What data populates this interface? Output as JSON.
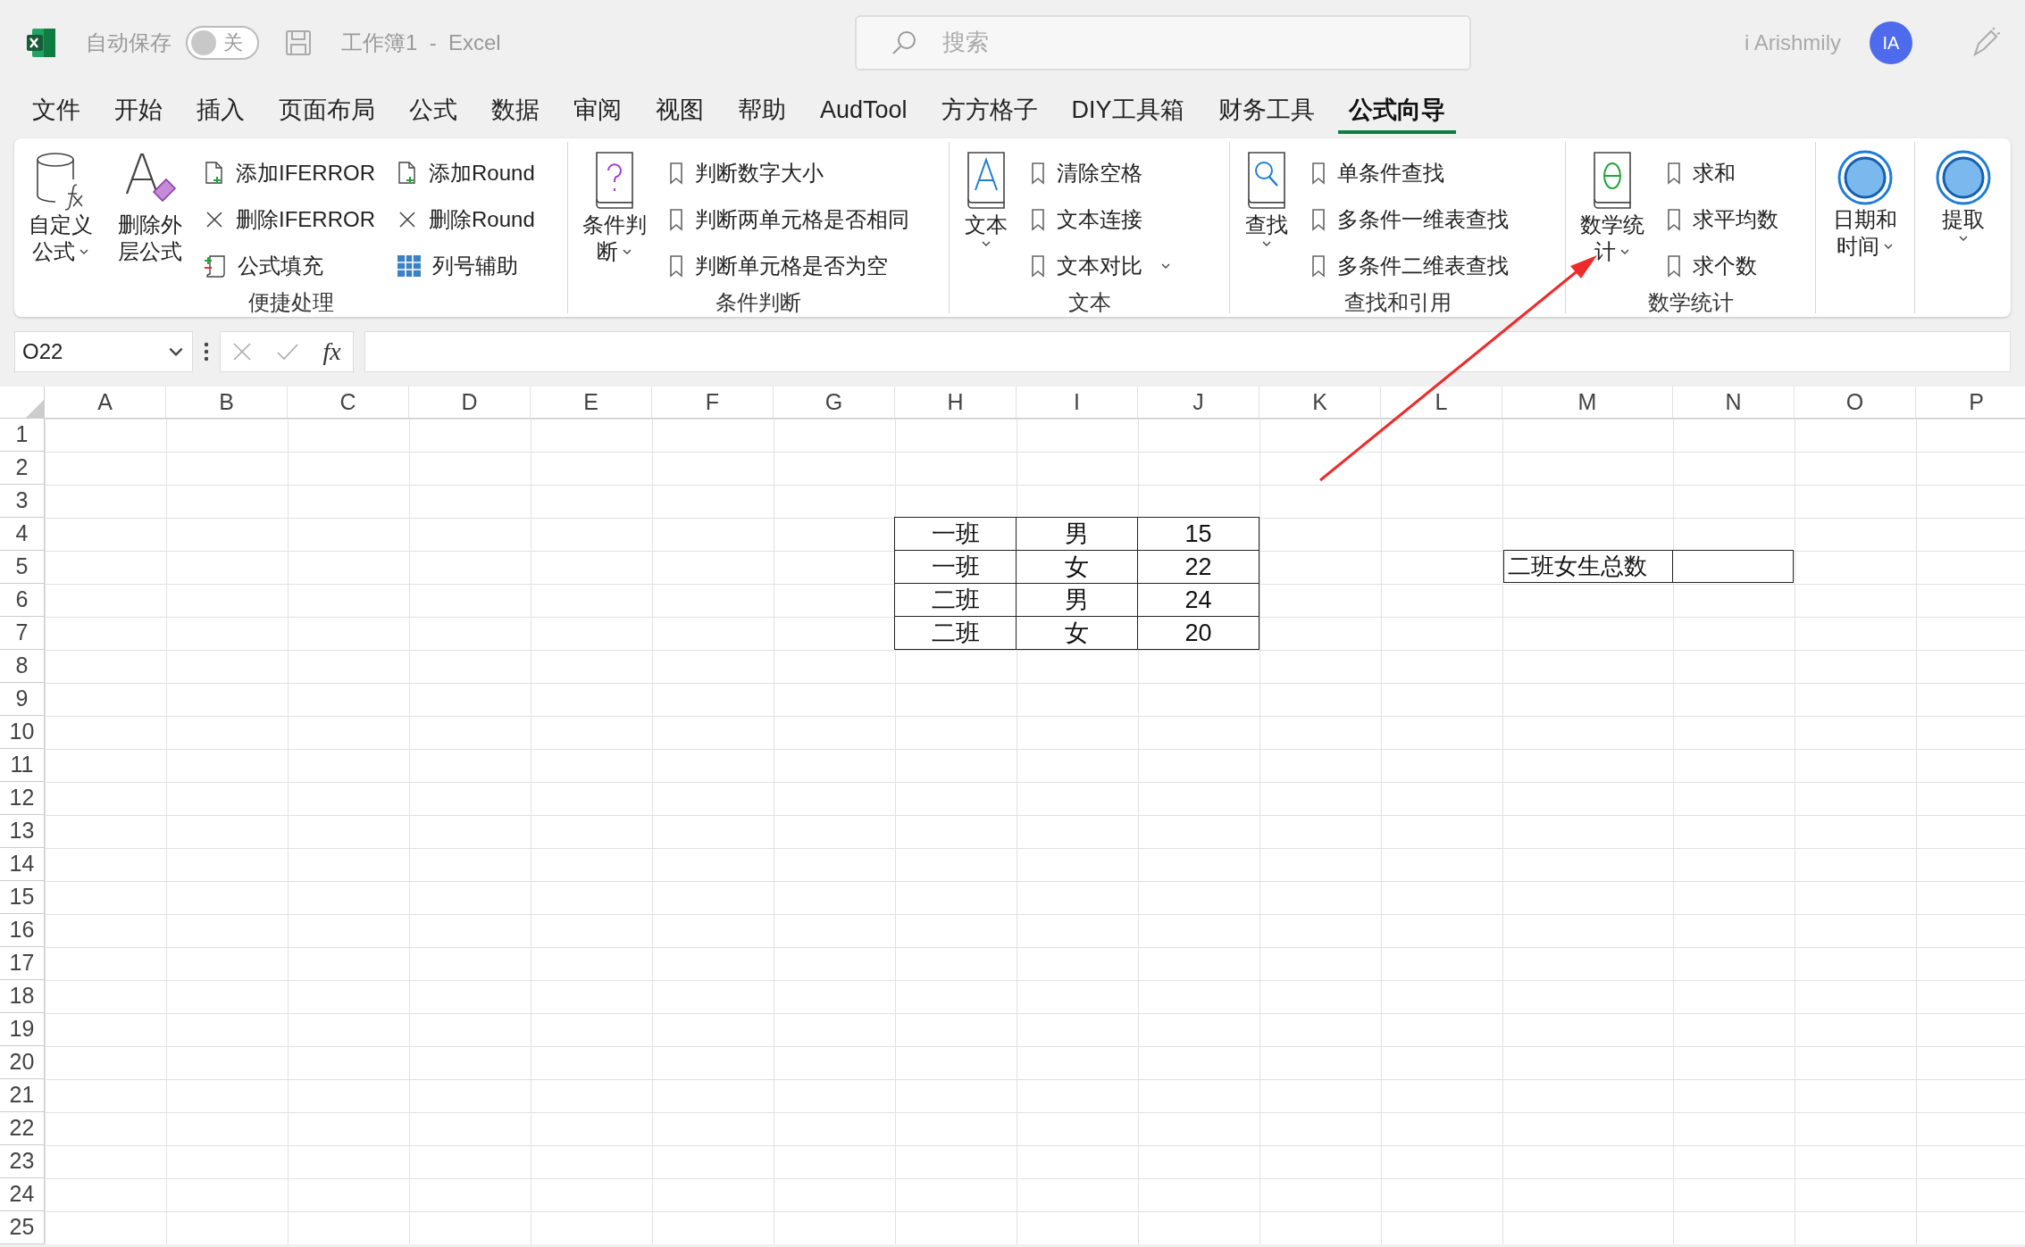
{
  "titlebar": {
    "autosave_label": "自动保存",
    "autosave": {
      "on": false,
      "label": "关"
    },
    "title": "工作簿1  -  Excel",
    "search_placeholder": "搜索",
    "user": "i Arishmily",
    "avatar": "IA"
  },
  "menu_tabs": [
    {
      "label": "文件",
      "selected": false
    },
    {
      "label": "开始",
      "selected": false
    },
    {
      "label": "插入",
      "selected": false
    },
    {
      "label": "页面布局",
      "selected": false
    },
    {
      "label": "公式",
      "selected": false
    },
    {
      "label": "数据",
      "selected": false
    },
    {
      "label": "审阅",
      "selected": false
    },
    {
      "label": "视图",
      "selected": false
    },
    {
      "label": "帮助",
      "selected": false
    },
    {
      "label": "AudTool",
      "selected": false
    },
    {
      "label": "方方格子",
      "selected": false
    },
    {
      "label": "DIY工具箱",
      "selected": false
    },
    {
      "label": "财务工具",
      "selected": false
    },
    {
      "label": "公式向导",
      "selected": true
    }
  ],
  "ribbon_groups": [
    {
      "label": "便捷处理",
      "items": [
        {
          "kind": "large",
          "lines": [
            "自定义",
            "公式"
          ],
          "dropdown": true
        },
        {
          "kind": "large",
          "lines": [
            "删除外",
            "层公式"
          ],
          "dropdown": false
        },
        {
          "kind": "small",
          "label": "添加IFERROR",
          "dropdown": false
        },
        {
          "kind": "small",
          "label": "删除IFERROR",
          "dropdown": false
        },
        {
          "kind": "small",
          "label": "公式填充",
          "dropdown": false
        },
        {
          "kind": "small",
          "label": "添加Round",
          "dropdown": false
        },
        {
          "kind": "small",
          "label": "删除Round",
          "dropdown": false
        },
        {
          "kind": "small",
          "label": "列号辅助",
          "dropdown": false
        }
      ]
    },
    {
      "label": "条件判断",
      "items": [
        {
          "kind": "large",
          "lines": [
            "条件判",
            "断"
          ],
          "dropdown": true
        },
        {
          "kind": "small",
          "label": "判断数字大小",
          "dropdown": false
        },
        {
          "kind": "small",
          "label": "判断两单元格是否相同",
          "dropdown": false
        },
        {
          "kind": "small",
          "label": "判断单元格是否为空",
          "dropdown": false
        }
      ]
    },
    {
      "label": "文本",
      "items": [
        {
          "kind": "large",
          "lines": [
            "文本"
          ],
          "dropdown": true
        },
        {
          "kind": "small",
          "label": "清除空格",
          "dropdown": false
        },
        {
          "kind": "small",
          "label": "文本连接",
          "dropdown": false
        },
        {
          "kind": "small",
          "label": "文本对比",
          "dropdown": true
        }
      ]
    },
    {
      "label": "查找和引用",
      "items": [
        {
          "kind": "large",
          "lines": [
            "查找"
          ],
          "dropdown": true
        },
        {
          "kind": "small",
          "label": "单条件查找",
          "dropdown": false
        },
        {
          "kind": "small",
          "label": "多条件一维表查找",
          "dropdown": false
        },
        {
          "kind": "small",
          "label": "多条件二维表查找",
          "dropdown": false
        }
      ]
    },
    {
      "label": "数学统计",
      "items": [
        {
          "kind": "large",
          "lines": [
            "数学统",
            "计"
          ],
          "dropdown": true
        },
        {
          "kind": "small",
          "label": "求和",
          "dropdown": false
        },
        {
          "kind": "small",
          "label": "求平均数",
          "dropdown": false
        },
        {
          "kind": "small",
          "label": "求个数",
          "dropdown": false
        }
      ]
    },
    {
      "items": [
        {
          "kind": "large",
          "lines": [
            "日期和",
            "时间"
          ],
          "dropdown": true
        }
      ]
    },
    {
      "items": [
        {
          "kind": "large",
          "lines": [
            "提取"
          ],
          "dropdown": true
        }
      ]
    }
  ],
  "formula_bar": {
    "name_box": "O22",
    "fx": "fx"
  },
  "sheet": {
    "columns": [
      "A",
      "B",
      "C",
      "D",
      "E",
      "F",
      "G",
      "H",
      "I",
      "J",
      "K",
      "L",
      "M",
      "N",
      "O",
      "P"
    ],
    "rows": [
      "1",
      "2",
      "3",
      "4",
      "5",
      "6",
      "7",
      "8",
      "9",
      "10",
      "11",
      "12",
      "13",
      "14",
      "15",
      "16",
      "17",
      "18",
      "19",
      "20",
      "21",
      "22",
      "23",
      "24",
      "25"
    ],
    "data_table": [
      [
        "一班",
        "男",
        "15"
      ],
      [
        "一班",
        "女",
        "22"
      ],
      [
        "二班",
        "男",
        "24"
      ],
      [
        "二班",
        "女",
        "20"
      ]
    ],
    "summary": {
      "label": "二班女生总数"
    }
  },
  "annotation": {
    "kind": "arrow"
  }
}
